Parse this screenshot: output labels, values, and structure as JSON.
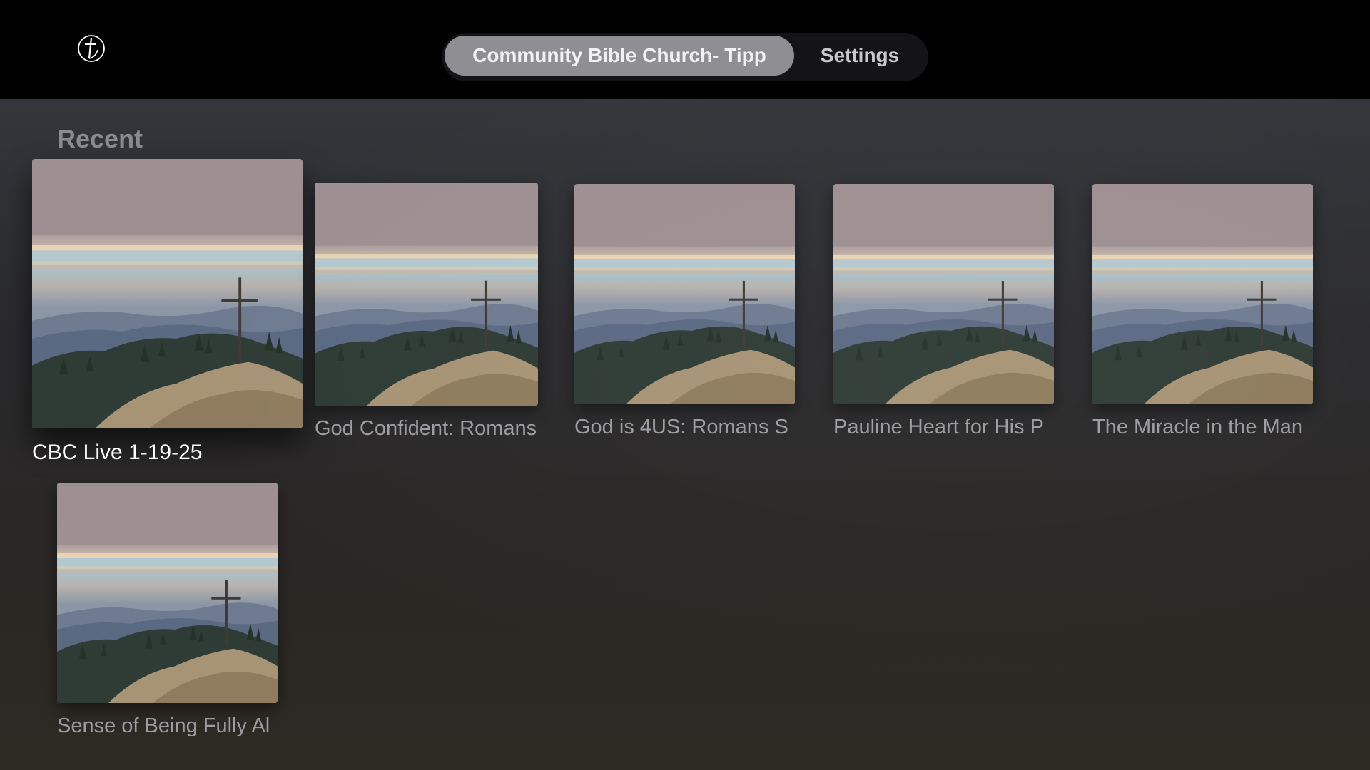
{
  "nav": {
    "tabs": [
      {
        "label": "Community Bible Church- Tipp",
        "active": true
      },
      {
        "label": "Settings",
        "active": false
      }
    ]
  },
  "section": {
    "title": "Recent"
  },
  "items": [
    {
      "label": "CBC Live 1-19-25",
      "focused": true
    },
    {
      "label": "God Confident: Romans",
      "focused": false
    },
    {
      "label": "God is 4US: Romans S",
      "focused": false
    },
    {
      "label": "Pauline Heart for His P",
      "focused": false
    },
    {
      "label": "The Miracle in the Man",
      "focused": false
    },
    {
      "label": "Sense of Being Fully Al",
      "focused": false
    }
  ],
  "colors": {
    "topbar": "#000000",
    "active_tab": "#8e8e93",
    "focused_label": "#ffffff",
    "label": "#9c9ca2"
  }
}
